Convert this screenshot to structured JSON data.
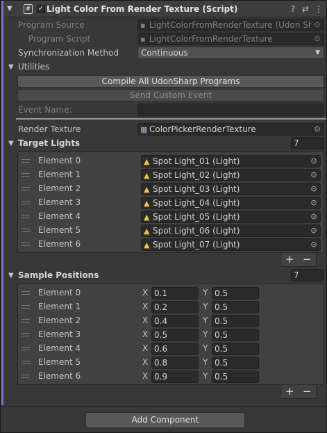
{
  "component": {
    "title": "Light Color From Render Texture (Script)",
    "enabled_check": "✓",
    "script_icon": "#"
  },
  "header_icons": [
    "help-icon",
    "presets-icon",
    "more-icon"
  ],
  "header_glyphs": {
    "help": "?",
    "presets": "⇄",
    "more": "⋮"
  },
  "fields": {
    "program_source_label": "Program Source",
    "program_source_value": "LightColorFromRenderTexture (Udon Shar",
    "program_script_label": "Program Script",
    "program_script_value": "LightColorFromRenderTexture",
    "sync_label": "Synchronization Method",
    "sync_value": "Continuous"
  },
  "utilities": {
    "label": "Utilities",
    "compile_button": "Compile All UdonSharp Programs",
    "send_event_button": "Send Custom Event",
    "event_name_label": "Event Name:",
    "event_name_value": ""
  },
  "render_texture": {
    "label": "Render Texture",
    "value": "ColorPickerRenderTexture"
  },
  "target_lights": {
    "label": "Target Lights",
    "size": "7",
    "items": [
      {
        "label": "Element 0",
        "value": "Spot Light_01 (Light)"
      },
      {
        "label": "Element 1",
        "value": "Spot Light_02 (Light)"
      },
      {
        "label": "Element 2",
        "value": "Spot Light_03 (Light)"
      },
      {
        "label": "Element 3",
        "value": "Spot Light_04 (Light)"
      },
      {
        "label": "Element 4",
        "value": "Spot Light_05 (Light)"
      },
      {
        "label": "Element 5",
        "value": "Spot Light_06 (Light)"
      },
      {
        "label": "Element 6",
        "value": "Spot Light_07 (Light)"
      }
    ],
    "add": "+",
    "remove": "−"
  },
  "sample_positions": {
    "label": "Sample Positions",
    "size": "7",
    "x_label": "X",
    "y_label": "Y",
    "items": [
      {
        "label": "Element 0",
        "x": "0.1",
        "y": "0.5"
      },
      {
        "label": "Element 1",
        "x": "0.2",
        "y": "0.5"
      },
      {
        "label": "Element 2",
        "x": "0.4",
        "y": "0.5"
      },
      {
        "label": "Element 3",
        "x": "0.5",
        "y": "0.5"
      },
      {
        "label": "Element 4",
        "x": "0.6",
        "y": "0.5"
      },
      {
        "label": "Element 5",
        "x": "0.8",
        "y": "0.5"
      },
      {
        "label": "Element 6",
        "x": "0.9",
        "y": "0.5"
      }
    ],
    "add": "+",
    "remove": "−"
  },
  "add_component": "Add Component",
  "colors": {
    "accent": "#7b6ec7",
    "light_icon": "#f0c040"
  }
}
